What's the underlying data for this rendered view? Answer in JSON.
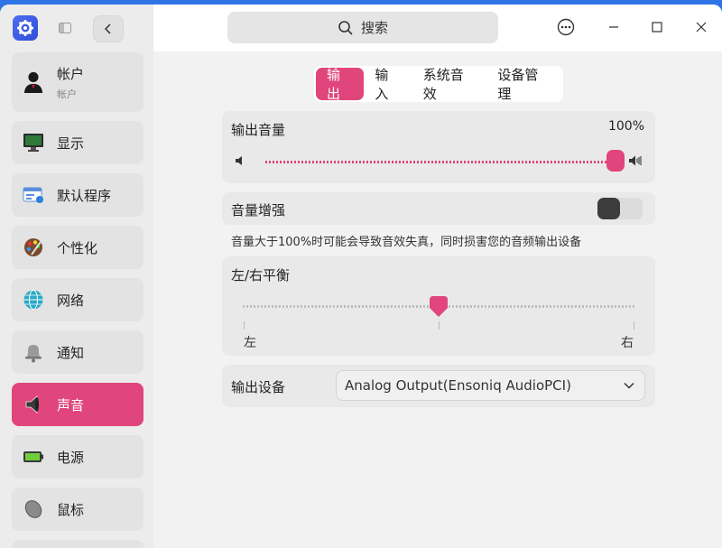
{
  "titlebar": {
    "search_placeholder": "搜索"
  },
  "sidebar": {
    "account": {
      "label": "帐户",
      "sublabel": "帐户"
    },
    "items": [
      {
        "label": "显示",
        "icon": "monitor-icon"
      },
      {
        "label": "默认程序",
        "icon": "default-apps-icon"
      },
      {
        "label": "个性化",
        "icon": "palette-icon"
      },
      {
        "label": "网络",
        "icon": "network-icon"
      },
      {
        "label": "通知",
        "icon": "bell-icon"
      },
      {
        "label": "声音",
        "icon": "speaker-icon",
        "active": true
      },
      {
        "label": "电源",
        "icon": "battery-icon"
      },
      {
        "label": "鼠标",
        "icon": "mouse-icon"
      }
    ]
  },
  "tabs": [
    {
      "label": "输出",
      "active": true
    },
    {
      "label": "输入"
    },
    {
      "label": "系统音效"
    },
    {
      "label": "设备管理"
    }
  ],
  "output_volume": {
    "label": "输出音量",
    "value_text": "100%",
    "level": 1.0
  },
  "volume_boost": {
    "label": "音量增强",
    "enabled": false
  },
  "boost_hint": "音量大于100%时可能会导致音效失真，同时损害您的音频输出设备",
  "balance": {
    "label": "左/右平衡",
    "left_label": "左",
    "right_label": "右",
    "level": 0.5
  },
  "output_device": {
    "label": "输出设备",
    "selected": "Analog Output(Ensoniq AudioPCI)"
  },
  "colors": {
    "accent": "#e0457b",
    "desktop": "#2f74e6"
  }
}
